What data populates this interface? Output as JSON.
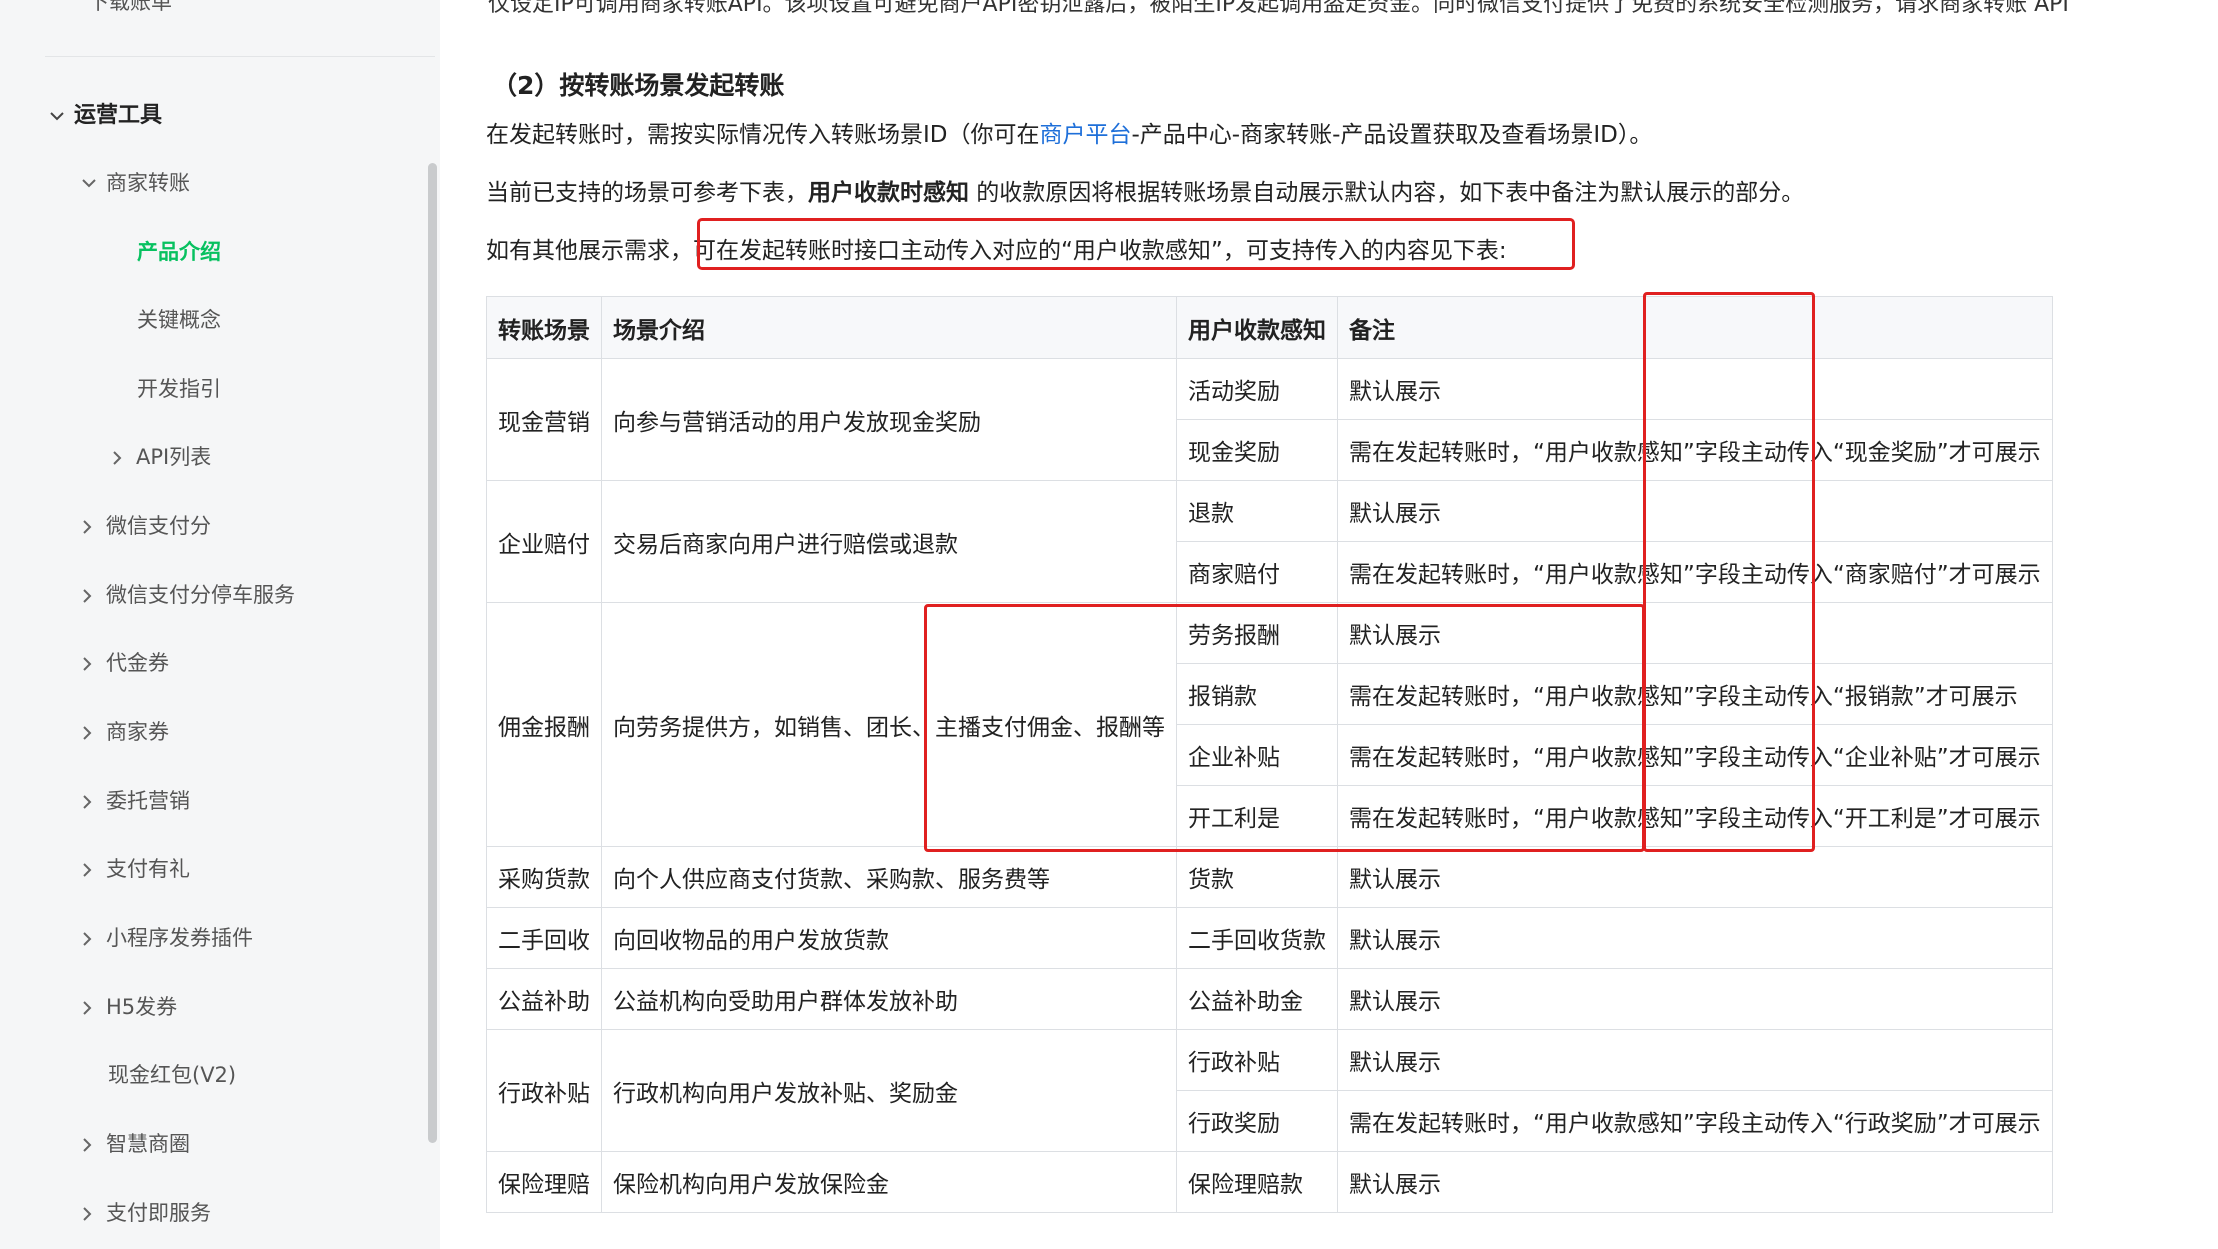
{
  "sidebar": {
    "top_cut_label": "下载账单",
    "section_title": "运营工具",
    "items": [
      {
        "label": "商家转账",
        "chevron": "down"
      },
      {
        "label": "产品介绍",
        "chevron": "none",
        "active": true
      },
      {
        "label": "关键概念",
        "chevron": "none"
      },
      {
        "label": "开发指引",
        "chevron": "none"
      },
      {
        "label": "API列表",
        "chevron": "right"
      },
      {
        "label": "微信支付分",
        "chevron": "right"
      },
      {
        "label": "微信支付分停车服务",
        "chevron": "right"
      },
      {
        "label": "代金券",
        "chevron": "right"
      },
      {
        "label": "商家券",
        "chevron": "right"
      },
      {
        "label": "委托营销",
        "chevron": "right"
      },
      {
        "label": "支付有礼",
        "chevron": "right"
      },
      {
        "label": "小程序发券插件",
        "chevron": "right"
      },
      {
        "label": "H5发券",
        "chevron": "right"
      },
      {
        "label": "现金红包(V2)",
        "chevron": "none"
      },
      {
        "label": "智慧商圈",
        "chevron": "right"
      },
      {
        "label": "支付即服务",
        "chevron": "right"
      }
    ]
  },
  "content": {
    "top_cut_text": "仅设定IP可调用商家转账API。该项设置可避免商户API密钥泄露后，被陌生IP发起调用盗走资金。同时微信支付提供了免费的系统安全检测服务，请求商家转账 API",
    "section_heading": "（2）按转账场景发起转账",
    "p1_before": "在发起转账时，需按实际情况传入转账场景ID（你可在",
    "p1_link": "商户平台",
    "p1_after": "-产品中心-商家转账-产品设置获取及查看场景ID）。",
    "p2_before": "当前已支持的场景可参考下表，",
    "p2_bold": "用户收款时感知",
    "p2_after": " 的收款原因将根据转账场景自动展示默认内容，如下表中备注为默认展示的部分。",
    "p3_before": "如有其他展示需求，",
    "p3_highlight": "可在发起转账时接口主动传入对应的“用户收款感知”，可支持传入的内容见下表",
    "p3_after": ":"
  },
  "table": {
    "headers": [
      "转账场景",
      "场景介绍",
      "用户收款感知",
      "备注"
    ],
    "rows": [
      {
        "scene": "现金营销",
        "intro": "向参与营销活动的用户发放现金奖励",
        "sub": [
          {
            "perception": "活动奖励",
            "note": "默认展示"
          },
          {
            "perception": "现金奖励",
            "note": "需在发起转账时，“用户收款感知”字段主动传入“现金奖励”才可展示"
          }
        ]
      },
      {
        "scene": "企业赔付",
        "intro": "交易后商家向用户进行赔偿或退款",
        "sub": [
          {
            "perception": "退款",
            "note": "默认展示"
          },
          {
            "perception": "商家赔付",
            "note": "需在发起转账时，“用户收款感知”字段主动传入“商家赔付”才可展示"
          }
        ]
      },
      {
        "scene": "佣金报酬",
        "intro": "向劳务提供方，如销售、团长、主播支付佣金、报酬等",
        "sub": [
          {
            "perception": "劳务报酬",
            "note": "默认展示"
          },
          {
            "perception": "报销款",
            "note": "需在发起转账时，“用户收款感知”字段主动传入“报销款”才可展示"
          },
          {
            "perception": "企业补贴",
            "note": "需在发起转账时，“用户收款感知”字段主动传入“企业补贴”才可展示"
          },
          {
            "perception": "开工利是",
            "note": "需在发起转账时，“用户收款感知”字段主动传入“开工利是”才可展示"
          }
        ]
      },
      {
        "scene": "采购货款",
        "intro": "向个人供应商支付货款、采购款、服务费等",
        "sub": [
          {
            "perception": "货款",
            "note": "默认展示"
          }
        ]
      },
      {
        "scene": "二手回收",
        "intro": "向回收物品的用户发放货款",
        "sub": [
          {
            "perception": "二手回收货款",
            "note": "默认展示"
          }
        ]
      },
      {
        "scene": "公益补助",
        "intro": "公益机构向受助用户群体发放补助",
        "sub": [
          {
            "perception": "公益补助金",
            "note": "默认展示"
          }
        ]
      },
      {
        "scene": "行政补贴",
        "intro": "行政机构向用户发放补贴、奖励金",
        "sub": [
          {
            "perception": "行政补贴",
            "note": "默认展示"
          },
          {
            "perception": "行政奖励",
            "note": "需在发起转账时，“用户收款感知”字段主动传入“行政奖励”才可展示"
          }
        ]
      },
      {
        "scene": "保险理赔",
        "intro": "保险机构向用户发放保险金",
        "sub": [
          {
            "perception": "保险理赔款",
            "note": "默认展示"
          }
        ]
      }
    ]
  },
  "colors": {
    "accent": "#07c160",
    "link": "#1e6fd9",
    "highlight_border": "#e02020",
    "sidebar_bg": "#f5f6f7"
  }
}
